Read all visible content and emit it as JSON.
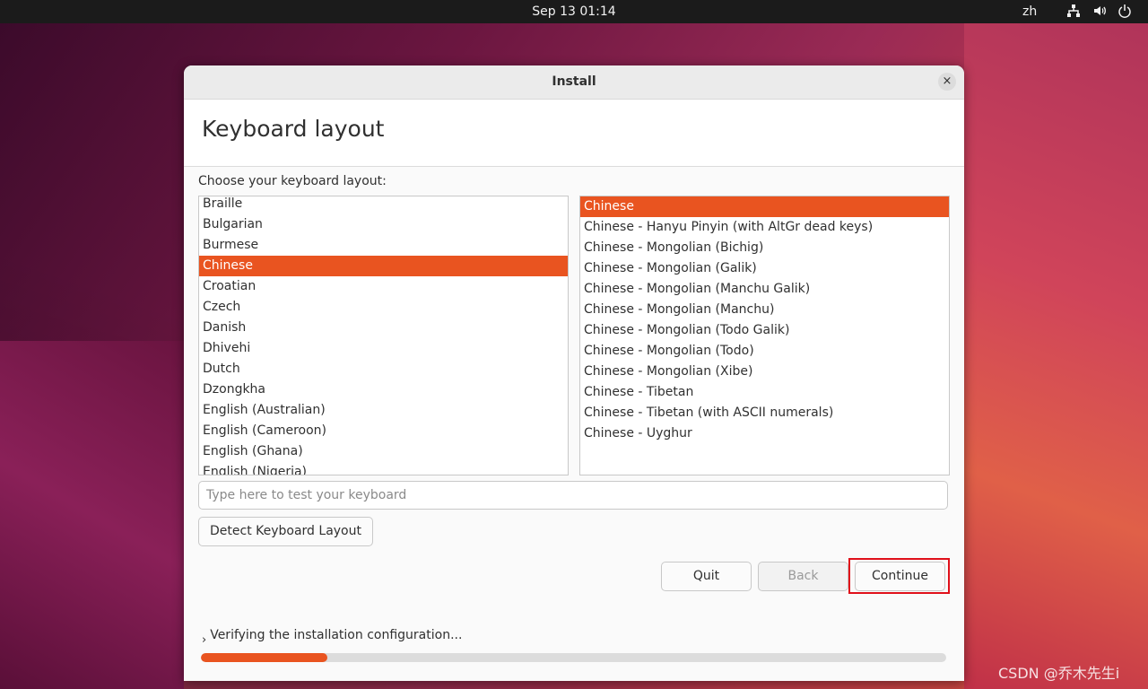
{
  "topbar": {
    "datetime": "Sep 13  01:14",
    "language": "zh",
    "tray_icons": [
      "network-icon",
      "volume-icon",
      "power-icon"
    ]
  },
  "window": {
    "title": "Install",
    "close_glyph": "×"
  },
  "page": {
    "heading": "Keyboard layout",
    "prompt": "Choose your keyboard layout:"
  },
  "layouts": {
    "selected": "Chinese",
    "items": [
      "Braille",
      "Bulgarian",
      "Burmese",
      "Chinese",
      "Croatian",
      "Czech",
      "Danish",
      "Dhivehi",
      "Dutch",
      "Dzongkha",
      "English (Australian)",
      "English (Cameroon)",
      "English (Ghana)",
      "English (Nigeria)"
    ]
  },
  "variants": {
    "selected": "Chinese",
    "items": [
      "Chinese",
      "Chinese - Hanyu Pinyin (with AltGr dead keys)",
      "Chinese - Mongolian (Bichig)",
      "Chinese - Mongolian (Galik)",
      "Chinese - Mongolian (Manchu Galik)",
      "Chinese - Mongolian (Manchu)",
      "Chinese - Mongolian (Todo Galik)",
      "Chinese - Mongolian (Todo)",
      "Chinese - Mongolian (Xibe)",
      "Chinese - Tibetan",
      "Chinese - Tibetan (with ASCII numerals)",
      "Chinese - Uyghur"
    ]
  },
  "test_input": {
    "placeholder": "Type here to test your keyboard",
    "value": ""
  },
  "buttons": {
    "detect": "Detect Keyboard Layout",
    "quit": "Quit",
    "back": "Back",
    "continue": "Continue"
  },
  "status": {
    "text": "Verifying the installation configuration...",
    "progress": 0.17
  },
  "colors": {
    "accent": "#e95420",
    "highlight_box": "#e0101a"
  },
  "watermark": "CSDN @乔木先生i"
}
